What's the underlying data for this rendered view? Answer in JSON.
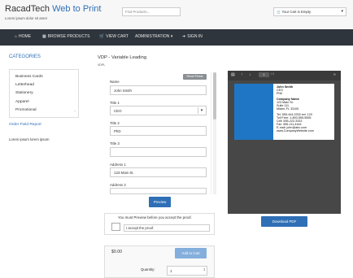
{
  "header": {
    "brand_part1": "RacadTech",
    "brand_part2": "Web to Print",
    "tagline": "Lorem ipsum dolor sit amet",
    "search_placeholder": "Find Products...",
    "cart_status": "Your Cart is Empty",
    "cart_icon": "cart-icon"
  },
  "nav": {
    "items": [
      {
        "label": "HOME",
        "icon": "home-icon"
      },
      {
        "label": "BROWSE PRODUCTS",
        "icon": "grid-icon"
      },
      {
        "label": "VIEW CART",
        "icon": "cart-icon"
      },
      {
        "label": "ADMINISTRATION",
        "icon": "chevron-down-icon"
      },
      {
        "label": "SIGN IN",
        "icon": "sign-in-icon"
      }
    ]
  },
  "sidebar": {
    "title": "CATEGORIES",
    "categories": [
      "Business Cards",
      "Letterhead",
      "Stationery",
      "Apparel",
      "Promotional"
    ],
    "order_field_report": "Order Field Report",
    "lorem": "Lorem ipsum lorem ipsum"
  },
  "form": {
    "title": "VDP - Variable Leading",
    "subtitle": "VDPL",
    "reset_label": "Reset Fields",
    "fields": [
      {
        "label": "Name",
        "value": "John Smith"
      },
      {
        "label": "Title 1",
        "value": "CEO"
      },
      {
        "label": "Title 2",
        "value": "PhD"
      },
      {
        "label": "Title 3",
        "value": ""
      },
      {
        "label": "Address 1",
        "value": "123 Main St."
      },
      {
        "label": "Address 2",
        "value": ""
      }
    ],
    "preview_label": "Preview",
    "proof_message": "You must Preview before you accept the proof.",
    "proof_accept_label": "I accept the proof."
  },
  "cart": {
    "price": "$0.00",
    "add_to_cart_label": "Add to Cart",
    "quantity_label": "Quantity:",
    "quantity_value": "1"
  },
  "viewer": {
    "page_current": "1",
    "page_total": "/ 1",
    "card_lines": [
      "John Smith",
      "CEO",
      "PhD",
      "Company Name",
      "123 Main St.",
      "Suite 111",
      "Miami, FL 33100",
      "Tel: 555-444-3333 ext. 120",
      "Toll Free: 1-800-555-5555",
      "Cell: 555-222-3333",
      "Fax: 555-111-4444",
      "E-mail: john@abc.com",
      "www.CompanyWebsite.com"
    ],
    "download_label": "Download PDF"
  },
  "colors": {
    "accent": "#2f6fb5",
    "nav_bg": "#2f353d",
    "card_blue": "#1f76c5"
  }
}
